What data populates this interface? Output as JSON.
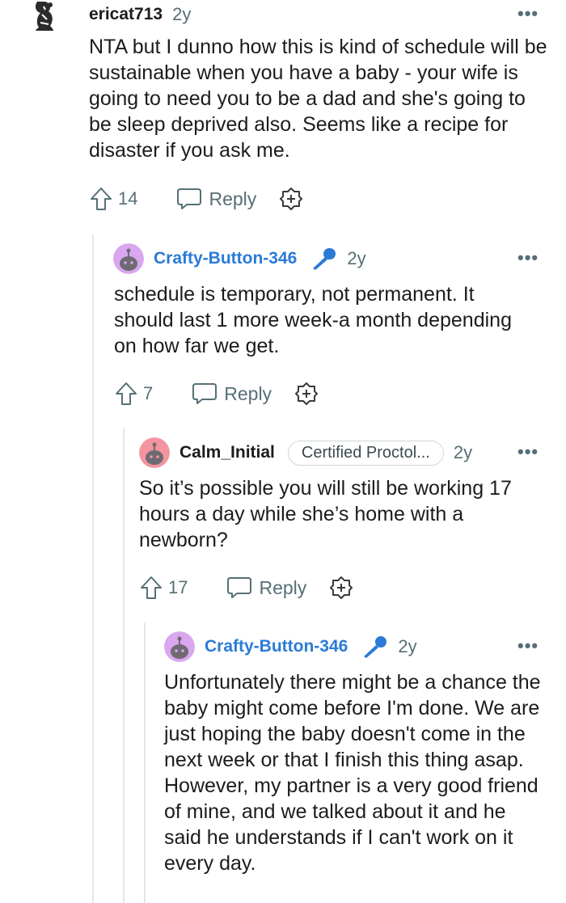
{
  "comments": [
    {
      "username": "ericat713",
      "time": "2y",
      "body": "NTA but I dunno how this is kind of schedule will be sustainable when you have a baby - your wife is going to need you to be a dad and she's going to be sleep deprived also. Seems like a recipe for disaster if you ask me.",
      "votes": "14",
      "reply_label": "Reply",
      "more_label": "•••",
      "avatar_icon": "snoo-avatar-icon"
    },
    {
      "username": "Crafty-Button-346",
      "time": "2y",
      "is_op": true,
      "body": "schedule is temporary, not permanent. It should last 1 more week-a month depending on how far we get.",
      "votes": "7",
      "reply_label": "Reply",
      "more_label": "•••",
      "avatar_color": "#d9a6ef",
      "badge_icon": "microphone-icon"
    },
    {
      "username": "Calm_Initial",
      "flair": "Certified Proctol...",
      "time": "2y",
      "body": "So it’s possible you will still be working 17 hours a day while she’s home with a newborn?",
      "votes": "17",
      "reply_label": "Reply",
      "more_label": "•••",
      "avatar_color": "#f4949f"
    },
    {
      "username": "Crafty-Button-346",
      "time": "2y",
      "is_op": true,
      "body": "Unfortunately there might be a chance the baby might come before I'm done. We are just hoping the baby doesn't come in the next week or that I finish this thing asap. However, my partner is a very good friend of mine, and we talked about it and he said he understands if I can't work on it every day.",
      "more_label": "•••",
      "avatar_color": "#d9a6ef",
      "badge_icon": "microphone-icon"
    }
  ],
  "colors": {
    "op_username": "#2a7bd6",
    "meta_gray": "#576f76",
    "thread_line": "#e4e6e8"
  }
}
